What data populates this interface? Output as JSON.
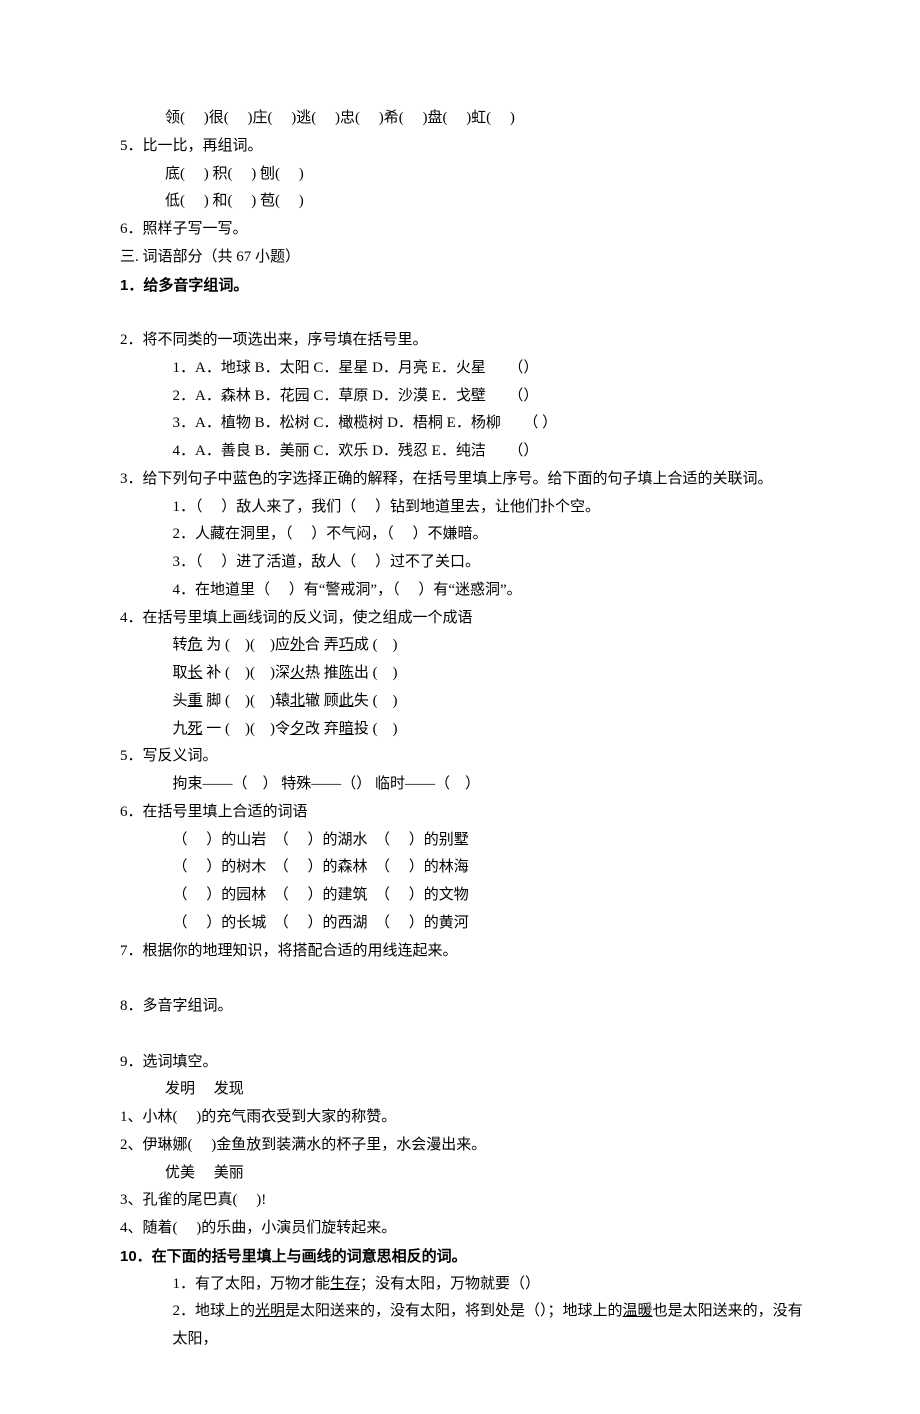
{
  "line1": "　　领(　 )很(　 )庄(　 )逃(　 )忠(　 )希(　 )盘(　 )虹(　 )",
  "q5": {
    "t": "5．比一比，再组词。",
    "a": "　　底(　 )  积(　 )  刨(　 )",
    "b": "　　低(　 )  和(　 )  苞(　 )"
  },
  "q6": "6．照样子写一写。",
  "sec3": "三.  词语部分（共  67  小题）",
  "w1": "1．给多音字组词。",
  "w2": {
    "t": "2．将不同类的一项选出来，序号填在括号里。",
    "r": [
      "1．A．地球  B．太阳  C．星星  D．月亮  E．火星　　（）",
      "2．A．森林  B．花园  C．草原  D．沙漠  E．戈壁　　（）",
      "3．A．植物  B．松树  C．橄榄树  D．梧桐  E．杨柳　　（  ）",
      "4．A．善良  B．美丽  C．欢乐  D．残忍  E．纯洁　　（）"
    ]
  },
  "w3": {
    "t": "3．给下列句子中蓝色的字选择正确的解释，在括号里填上序号。给下面的句子填上合适的关联词。",
    "r": [
      "1．（　 ）敌人来了，我们（　 ）钻到地道里去，让他们扑个空。",
      "2．人藏在洞里，（　 ）不气闷，（　 ）不嫌暗。",
      "3．（　 ）进了活道，敌人（　 ）过不了关口。",
      "4．在地道里（　 ）有“警戒洞”，（　 ）有“迷惑洞”。"
    ]
  },
  "w4": {
    "t": "4．在括号里填上画线词的反义词，使之组成一个成语",
    "r": [
      [
        "转",
        "危",
        " 为  (　)(　)应",
        "外",
        "合  弄",
        "巧",
        "成  (　)"
      ],
      [
        "取",
        "长",
        " 补  (　)(　)深",
        "火",
        "热  推",
        "陈",
        "出  (　)"
      ],
      [
        "头",
        "重",
        " 脚  (　)(　)辕",
        "北",
        "辙  顾",
        "此",
        "失  (　)"
      ],
      [
        "九",
        "死",
        " 一  (　)(　)令",
        "夕",
        "改  弃",
        "暗",
        "投  (　)"
      ]
    ]
  },
  "w5": {
    "t": "5．写反义词。",
    "a": "拘束——（　）  特殊——（）  临时——（　）"
  },
  "w6": {
    "t": "6．在括号里填上合适的词语",
    "r": [
      "（　 ）的山岩　（　 ）的湖水　（　 ）的别墅",
      "（　 ）的树木　（　 ）的森林　（　 ）的林海",
      "（　 ）的园林　（　 ）的建筑　（　 ）的文物",
      "（　 ）的长城　（　 ）的西湖　（　 ）的黄河"
    ]
  },
  "w7": "7．根据你的地理知识，将搭配合适的用线连起来。",
  "w8": "8．多音字组词。",
  "w9": {
    "t": "9．选词填空。",
    "g1": "　　发明　 发现",
    "r1": "  1、小林(　 )的充气雨衣受到大家的称赞。",
    "r2": "  2、伊琳娜(　 )金鱼放到装满水的杯子里，水会漫出来。",
    "g2": "　　优美　 美丽",
    "r3": "  3、孔雀的尾巴真(　 )!",
    "r4": "  4、随着(　 )的乐曲，小演员们旋转起来。"
  },
  "w10": {
    "t": "10．在下面的括号里填上与画线的词意思相反的词。",
    "r": [
      [
        "1．有了太阳，万物才能",
        "生存",
        "；没有太阳，万物就要（）"
      ],
      [
        "2．地球上的",
        "光明",
        "是太阳送来的，没有太阳，将到处是（）；地球上的",
        "温暖",
        "也是太阳送来的，没有太阳，"
      ]
    ]
  }
}
